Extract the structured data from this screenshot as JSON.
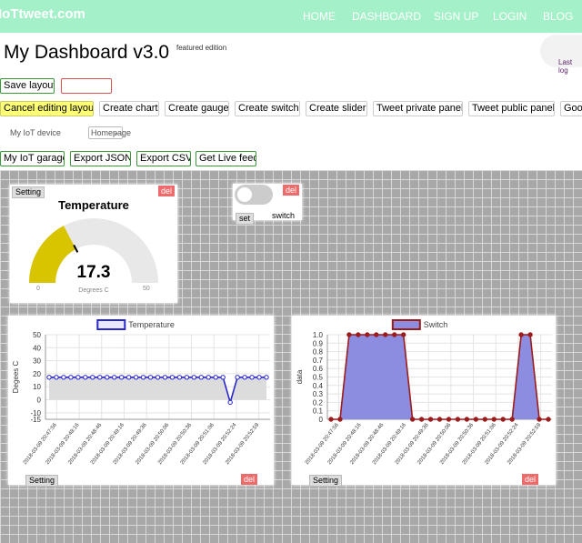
{
  "nav": {
    "brand": "IoTtweet.com",
    "links": [
      "HOME",
      "DASHBOARD",
      "SIGN UP",
      "LOGIN",
      "BLOG"
    ]
  },
  "header": {
    "title": "My Dashboard v3.0",
    "edition": "featured edition",
    "last_login": "Last log"
  },
  "toolbar": {
    "save": "Save layout",
    "cancel": "Cancel editing layout",
    "create_chart": "Create chart",
    "create_gauge": "Create gauge",
    "create_switch": "Create switch",
    "create_slider": "Create slider",
    "tweet_private": "Tweet private panel",
    "tweet_public": "Tweet public panel",
    "google": "Goog",
    "device_label": "My IoT device",
    "device_value": "Homepage",
    "garage": "My IoT garage",
    "export_json": "Export JSON",
    "export_csv": "Export CSV",
    "live_feed": "Get Live feed"
  },
  "gauge": {
    "setting": "Setting",
    "del": "del",
    "title": "Temperature",
    "value": "17.3",
    "min": "0",
    "max": "50",
    "unit": "Degrees C",
    "color": "#d9c400"
  },
  "switch_widget": {
    "del": "del",
    "set": "set",
    "label": "switch",
    "state": "off"
  },
  "chart_data": [
    {
      "type": "line",
      "title": "Temperature",
      "setting": "Setting",
      "del": "del",
      "ylabel": "Degees C",
      "ylim": [
        -15,
        50
      ],
      "yticks": [
        50,
        40,
        30,
        20,
        10,
        0,
        -10,
        -15
      ],
      "xticks": [
        "2018-03-09 20:47:56",
        "2018-03-09 20:48:16",
        "2018-03-09 20:48:46",
        "2018-03-09 20:49:16",
        "2018-03-09 20:49:36",
        "2018-03-09 20:50:06",
        "2018-03-09 20:50:36",
        "2018-03-09 20:51:06",
        "2018-03-09 20:52:24",
        "2018-03-09 20:52:59"
      ],
      "color": "#2828c8",
      "values": [
        17.3,
        17.3,
        17.3,
        17.3,
        17.3,
        17.3,
        17.3,
        17.3,
        17.3,
        17.3,
        17.3,
        17.3,
        17.3,
        17.3,
        17.3,
        17.3,
        17.3,
        17.3,
        17.3,
        17.3,
        17.3,
        17.3,
        17.3,
        17.3,
        17.3,
        -2,
        17.3,
        17.3,
        17.3,
        17.3,
        17.3
      ]
    },
    {
      "type": "area",
      "title": "Switch",
      "setting": "Setting",
      "del": "del",
      "ylabel": "data",
      "ylim": [
        0,
        1
      ],
      "yticks": [
        1.0,
        0.9,
        0.8,
        0.7,
        0.6,
        0.5,
        0.4,
        0.3,
        0.2,
        0.1,
        0
      ],
      "xticks": [
        "2018-03-09 20:47:56",
        "2018-03-09 20:48:16",
        "2018-03-09 20:48:46",
        "2018-03-09 20:49:16",
        "2018-03-09 20:49:36",
        "2018-03-09 20:50:06",
        "2018-03-09 20:50:36",
        "2018-03-09 20:51:06",
        "2018-03-09 20:52:24",
        "2018-03-09 20:52:59"
      ],
      "color": "#9b1c1c",
      "fill": "#8c8ce0",
      "values": [
        0,
        0,
        1,
        1,
        1,
        1,
        1,
        1,
        1,
        0,
        0,
        0,
        0,
        0,
        0,
        0,
        0,
        0,
        0,
        0,
        0,
        1,
        1,
        0,
        0
      ]
    }
  ]
}
